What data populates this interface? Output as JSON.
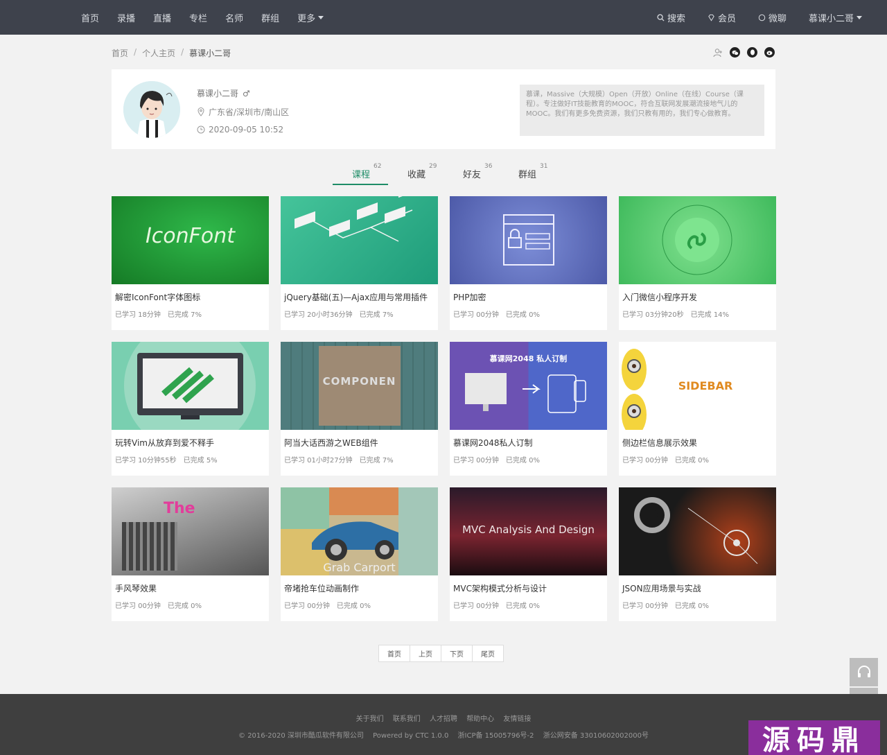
{
  "nav": {
    "left": [
      "首页",
      "录播",
      "直播",
      "专栏",
      "名师",
      "群组"
    ],
    "more": "更多",
    "search": "搜索",
    "vip": "会员",
    "chat": "微聊",
    "user": "慕课小二哥"
  },
  "breadcrumb": [
    "首页",
    "个人主页",
    "慕课小二哥"
  ],
  "profile": {
    "name": "慕课小二哥",
    "gender_symbol": "♂",
    "location": "广东省/深圳市/南山区",
    "joined": "2020-09-05 10:52",
    "bio": "慕课，Massive（大规模）Open（开放）Online（在线）Course（课程）。专注做好IT技能教育的MOOC，符合互联网发展潮流接地气儿的MOOC。我们有更多免费资源，我们只教有用的，我们专心做教育。"
  },
  "tabs": [
    {
      "label": "课程",
      "count": "62"
    },
    {
      "label": "收藏",
      "count": "29"
    },
    {
      "label": "好友",
      "count": "36"
    },
    {
      "label": "群组",
      "count": "31"
    }
  ],
  "courses": [
    {
      "title": "解密IconFont字体图标",
      "studied": "已学习 18分钟",
      "done": "已完成 7%",
      "thumb_text": "IconFont",
      "bg": "#1f8f2e"
    },
    {
      "title": "jQuery基础(五)—Ajax应用与常用插件",
      "studied": "已学习 20小时36分钟",
      "done": "已完成 7%",
      "thumb_text": "",
      "bg": "#2fb58e"
    },
    {
      "title": "PHP加密",
      "studied": "已学习 00分钟",
      "done": "已完成 0%",
      "thumb_text": "",
      "bg": "#6a78c8"
    },
    {
      "title": "入门微信小程序开发",
      "studied": "已学习 03分钟20秒",
      "done": "已完成 14%",
      "thumb_text": "",
      "bg": "#4fc36c"
    },
    {
      "title": "玩转Vim从放弃到爱不释手",
      "studied": "已学习 10分钟55秒",
      "done": "已完成 5%",
      "thumb_text": "",
      "bg": "#79cfb0"
    },
    {
      "title": "阿当大话西游之WEB组件",
      "studied": "已学习 01小时27分钟",
      "done": "已完成 7%",
      "thumb_text": "COMPONEN",
      "bg": "#4e7a7a"
    },
    {
      "title": "慕课网2048私人订制",
      "studied": "已学习 00分钟",
      "done": "已完成 0%",
      "thumb_text": "慕课网2048 私人订制",
      "bg": "#6957b8"
    },
    {
      "title": "侧边栏信息展示效果",
      "studied": "已学习 00分钟",
      "done": "已完成 0%",
      "thumb_text": "SIDEBAR",
      "bg": "#ffffff"
    },
    {
      "title": "手风琴效果",
      "studied": "已学习 00分钟",
      "done": "已完成 0%",
      "thumb_text": "The",
      "bg": "#8c8c8c"
    },
    {
      "title": "帝堵抢车位动画制作",
      "studied": "已学习 00分钟",
      "done": "已完成 0%",
      "thumb_text": "Grab Carport",
      "bg": "#c9b88f"
    },
    {
      "title": "MVC架构模式分析与设计",
      "studied": "已学习 00分钟",
      "done": "已完成 0%",
      "thumb_text": "MVC Analysis And Design",
      "bg": "#4a1a20"
    },
    {
      "title": "JSON应用场景与实战",
      "studied": "已学习 00分钟",
      "done": "已完成 0%",
      "thumb_text": "",
      "bg": "#1a1a1a"
    }
  ],
  "pager": [
    "首页",
    "上页",
    "下页",
    "尾页"
  ],
  "footer": {
    "links": [
      "关于我们",
      "联系我们",
      "人才招聘",
      "帮助中心",
      "友情链接"
    ],
    "copyright": "© 2016-2020 深圳市酷瓜软件有限公司",
    "powered": "Powered by CTC 1.0.0",
    "icp": "浙ICP备 15005796号-2",
    "police": "浙公网安备 33010602002000号"
  },
  "watermark": "源码鼎"
}
